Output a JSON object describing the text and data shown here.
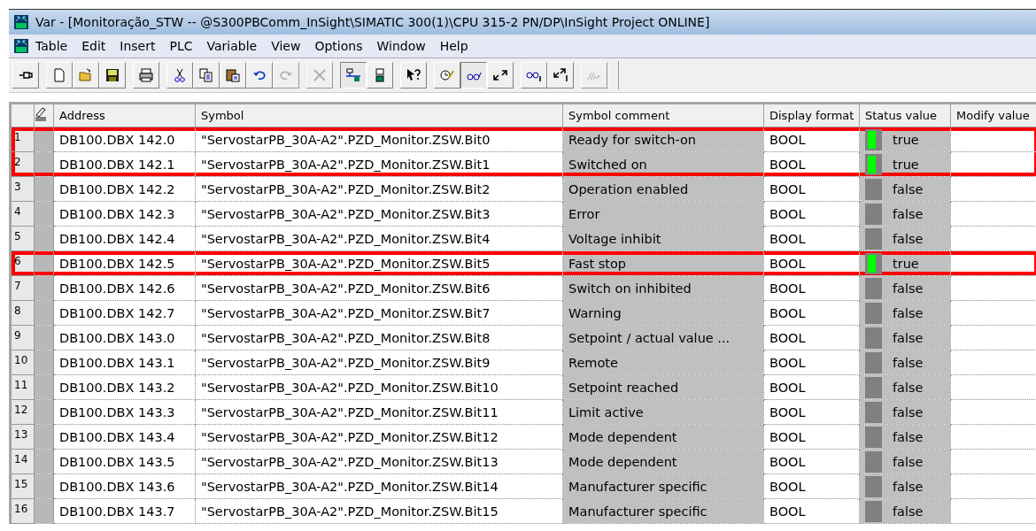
{
  "window": {
    "title": "Var - [Monitoração_STW -- @S300PBComm_InSight\\SIMATIC 300(1)\\CPU 315-2 PN/DP\\InSight Project  ONLINE]"
  },
  "menu": [
    "Table",
    "Edit",
    "Insert",
    "PLC",
    "Variable",
    "View",
    "Options",
    "Window",
    "Help"
  ],
  "toolbar": [
    [
      {
        "kind": "pin",
        "pressed": false,
        "disabled": false
      }
    ],
    [
      {
        "kind": "new",
        "pressed": false,
        "disabled": false
      },
      {
        "kind": "open",
        "pressed": false,
        "disabled": false
      },
      {
        "kind": "save",
        "pressed": false,
        "disabled": false
      }
    ],
    [
      {
        "kind": "print",
        "pressed": false,
        "disabled": false
      }
    ],
    [
      {
        "kind": "cut",
        "pressed": false,
        "disabled": false
      },
      {
        "kind": "copy",
        "pressed": false,
        "disabled": false
      },
      {
        "kind": "paste",
        "pressed": false,
        "disabled": false
      },
      {
        "kind": "undo",
        "pressed": false,
        "disabled": false
      },
      {
        "kind": "redo",
        "pressed": false,
        "disabled": true
      }
    ],
    [
      {
        "kind": "delete",
        "pressed": false,
        "disabled": true
      }
    ],
    [
      {
        "kind": "network",
        "pressed": true,
        "disabled": false
      },
      {
        "kind": "station",
        "pressed": false,
        "disabled": false
      }
    ],
    [
      {
        "kind": "help",
        "pressed": false,
        "disabled": false
      }
    ],
    [
      {
        "kind": "trigger",
        "pressed": false,
        "disabled": false
      },
      {
        "kind": "monitor",
        "pressed": true,
        "disabled": false
      },
      {
        "kind": "modify",
        "pressed": false,
        "disabled": false
      }
    ],
    [
      {
        "kind": "monitor_once",
        "pressed": false,
        "disabled": false
      },
      {
        "kind": "modify_once",
        "pressed": false,
        "disabled": false
      }
    ],
    [
      {
        "kind": "force",
        "pressed": false,
        "disabled": true
      }
    ]
  ],
  "table": {
    "columns": [
      "Address",
      "Symbol",
      "Symbol comment",
      "Display format",
      "Status value",
      "Modify value"
    ],
    "rows": [
      {
        "number": "1",
        "address": "DB100.DBX  142.0",
        "symbol": "\"ServostarPB_30A-A2\".PZD_Monitor.ZSW.Bit0",
        "comment": "Ready for switch-on",
        "format": "BOOL",
        "status": "true",
        "on": true,
        "highlighted": true
      },
      {
        "number": "2",
        "address": "DB100.DBX  142.1",
        "symbol": "\"ServostarPB_30A-A2\".PZD_Monitor.ZSW.Bit1",
        "comment": "Switched on",
        "format": "BOOL",
        "status": "true",
        "on": true,
        "highlighted": true
      },
      {
        "number": "3",
        "address": "DB100.DBX  142.2",
        "symbol": "\"ServostarPB_30A-A2\".PZD_Monitor.ZSW.Bit2",
        "comment": "Operation enabled",
        "format": "BOOL",
        "status": "false",
        "on": false,
        "highlighted": false
      },
      {
        "number": "4",
        "address": "DB100.DBX  142.3",
        "symbol": "\"ServostarPB_30A-A2\".PZD_Monitor.ZSW.Bit3",
        "comment": "Error",
        "format": "BOOL",
        "status": "false",
        "on": false,
        "highlighted": false
      },
      {
        "number": "5",
        "address": "DB100.DBX  142.4",
        "symbol": "\"ServostarPB_30A-A2\".PZD_Monitor.ZSW.Bit4",
        "comment": "Voltage inhibit",
        "format": "BOOL",
        "status": "false",
        "on": false,
        "highlighted": false
      },
      {
        "number": "6",
        "address": "DB100.DBX  142.5",
        "symbol": "\"ServostarPB_30A-A2\".PZD_Monitor.ZSW.Bit5",
        "comment": "Fast stop",
        "format": "BOOL",
        "status": "true",
        "on": true,
        "highlighted": true
      },
      {
        "number": "7",
        "address": "DB100.DBX  142.6",
        "symbol": "\"ServostarPB_30A-A2\".PZD_Monitor.ZSW.Bit6",
        "comment": "Switch on inhibited",
        "format": "BOOL",
        "status": "false",
        "on": false,
        "highlighted": false
      },
      {
        "number": "8",
        "address": "DB100.DBX  142.7",
        "symbol": "\"ServostarPB_30A-A2\".PZD_Monitor.ZSW.Bit7",
        "comment": "Warning",
        "format": "BOOL",
        "status": "false",
        "on": false,
        "highlighted": false
      },
      {
        "number": "9",
        "address": "DB100.DBX  143.0",
        "symbol": "\"ServostarPB_30A-A2\".PZD_Monitor.ZSW.Bit8",
        "comment": "Setpoint / actual value ...",
        "format": "BOOL",
        "status": "false",
        "on": false,
        "highlighted": false
      },
      {
        "number": "10",
        "address": "DB100.DBX  143.1",
        "symbol": "\"ServostarPB_30A-A2\".PZD_Monitor.ZSW.Bit9",
        "comment": "Remote",
        "format": "BOOL",
        "status": "false",
        "on": false,
        "highlighted": false
      },
      {
        "number": "11",
        "address": "DB100.DBX  143.2",
        "symbol": "\"ServostarPB_30A-A2\".PZD_Monitor.ZSW.Bit10",
        "comment": "Setpoint reached",
        "format": "BOOL",
        "status": "false",
        "on": false,
        "highlighted": false
      },
      {
        "number": "12",
        "address": "DB100.DBX  143.3",
        "symbol": "\"ServostarPB_30A-A2\".PZD_Monitor.ZSW.Bit11",
        "comment": "Limit active",
        "format": "BOOL",
        "status": "false",
        "on": false,
        "highlighted": false
      },
      {
        "number": "13",
        "address": "DB100.DBX  143.4",
        "symbol": "\"ServostarPB_30A-A2\".PZD_Monitor.ZSW.Bit12",
        "comment": "Mode dependent",
        "format": "BOOL",
        "status": "false",
        "on": false,
        "highlighted": false
      },
      {
        "number": "14",
        "address": "DB100.DBX  143.5",
        "symbol": "\"ServostarPB_30A-A2\".PZD_Monitor.ZSW.Bit13",
        "comment": "Mode dependent",
        "format": "BOOL",
        "status": "false",
        "on": false,
        "highlighted": false
      },
      {
        "number": "15",
        "address": "DB100.DBX  143.6",
        "symbol": "\"ServostarPB_30A-A2\".PZD_Monitor.ZSW.Bit14",
        "comment": "Manufacturer specific",
        "format": "BOOL",
        "status": "false",
        "on": false,
        "highlighted": false
      },
      {
        "number": "16",
        "address": "DB100.DBX  143.7",
        "symbol": "\"ServostarPB_30A-A2\".PZD_Monitor.ZSW.Bit15",
        "comment": "Manufacturer specific",
        "format": "BOOL",
        "status": "false",
        "on": false,
        "highlighted": false
      }
    ]
  }
}
